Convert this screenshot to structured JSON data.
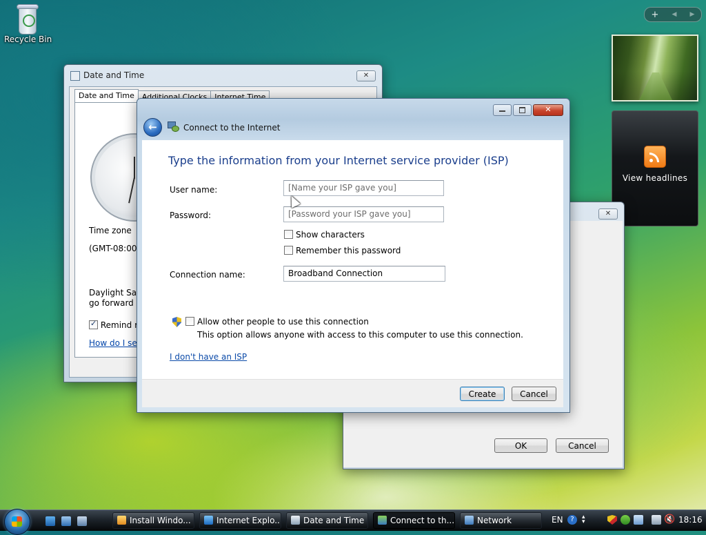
{
  "desktop": {
    "recycle_bin_label": "Recycle Bin"
  },
  "sidebar": {
    "feed_label": "View headlines",
    "add_symbol": "+",
    "prev_symbol": "◀",
    "next_symbol": "▶"
  },
  "datetime_window": {
    "title": "Date and Time",
    "tabs": [
      "Date and Time",
      "Additional Clocks",
      "Internet Time"
    ],
    "time_zone_label": "Time zone",
    "time_zone_value": "(GMT-08:00) I",
    "dst_line1": "Daylight Savi",
    "dst_line2": "go forward 1",
    "remind_label": "Remind m",
    "help_link": "How do I set"
  },
  "clock_window": {
    "ok_label": "OK",
    "cancel_label": "Cancel"
  },
  "connect_window": {
    "title": "Connect to the Internet",
    "heading": "Type the information from your Internet service provider (ISP)",
    "user_name_label": "User name:",
    "user_name_placeholder": "[Name your ISP gave you]",
    "password_label": "Password:",
    "password_placeholder": "[Password your ISP gave you]",
    "show_characters_label": "Show characters",
    "remember_password_label": "Remember this password",
    "connection_name_label": "Connection name:",
    "connection_name_value": "Broadband Connection",
    "allow_others_label": "Allow other people to use this connection",
    "allow_others_desc": "This option allows anyone with access to this computer to use this connection.",
    "no_isp_link": "I don't have an ISP",
    "create_label": "Create",
    "cancel_label": "Cancel",
    "show_characters_checked": false,
    "remember_password_checked": false,
    "allow_others_checked": false
  },
  "taskbar": {
    "buttons": [
      {
        "label": "Install Windo...",
        "icon": "setup-icon"
      },
      {
        "label": "Internet Explo...",
        "icon": "ie-icon"
      },
      {
        "label": "Date and Time",
        "icon": "clock-icon"
      },
      {
        "label": "Connect to th...",
        "icon": "network-icon",
        "active": true
      },
      {
        "label": "Network",
        "icon": "network-folder-icon"
      }
    ],
    "language": "EN",
    "clock": "18:16"
  },
  "colors": {
    "heading_blue": "#1a3e8c",
    "link_blue": "#0b4aa8",
    "taskbar": "#1d242b"
  }
}
